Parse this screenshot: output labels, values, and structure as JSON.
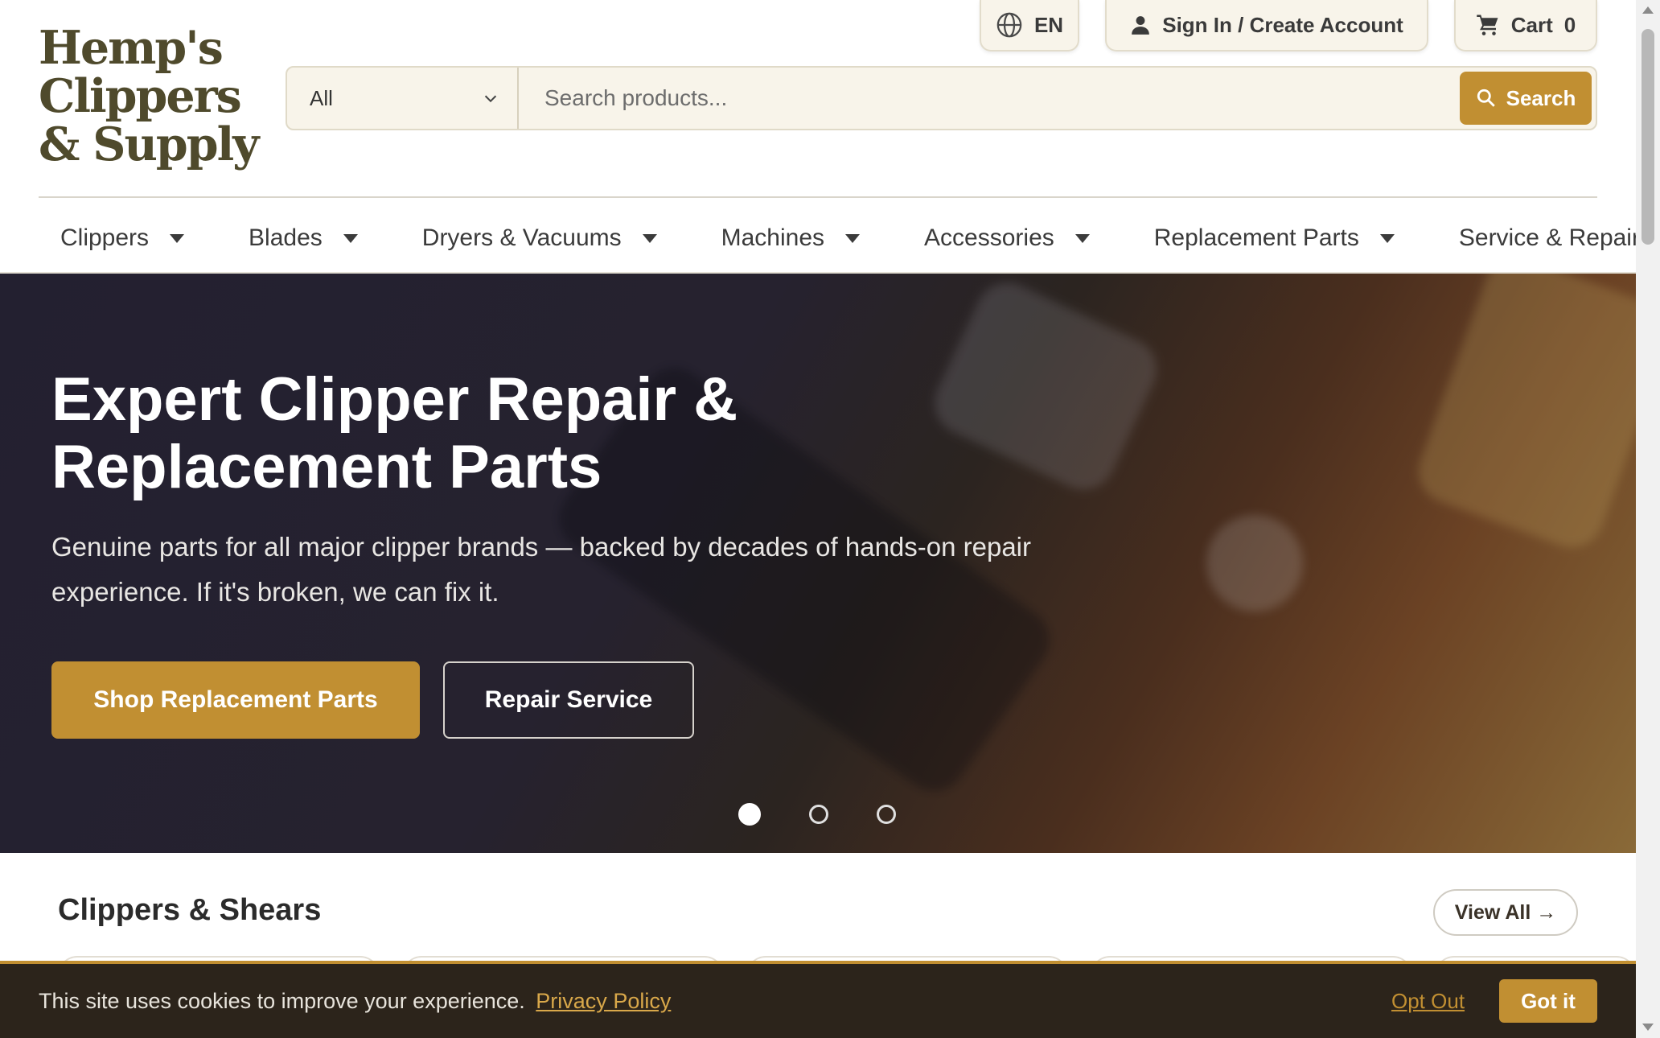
{
  "brand": {
    "logo_lines": [
      "Hemp's",
      "Clippers",
      "& Supply"
    ],
    "accent_color": "#c18f32",
    "logo_color": "#4f4a2c"
  },
  "utility": {
    "language": "EN",
    "account_label": "Sign In / Create Account",
    "cart_label": "Cart",
    "cart_count": "0"
  },
  "search": {
    "category": "All",
    "placeholder": "Search products...",
    "button_label": "Search"
  },
  "nav": {
    "items": [
      {
        "label": "Clippers",
        "has_dropdown": true
      },
      {
        "label": "Blades",
        "has_dropdown": true
      },
      {
        "label": "Dryers & Vacuums",
        "has_dropdown": true
      },
      {
        "label": "Machines",
        "has_dropdown": true
      },
      {
        "label": "Accessories",
        "has_dropdown": true
      },
      {
        "label": "Replacement Parts",
        "has_dropdown": true
      },
      {
        "label": "Service & Repair",
        "has_dropdown": false
      }
    ]
  },
  "hero": {
    "title": "Expert Clipper Repair & Replacement Parts",
    "subtitle": "Genuine parts for all major clipper brands — backed by decades of hands-on repair experience. If it's broken, we can fix it.",
    "primary_cta": "Shop Replacement Parts",
    "secondary_cta": "Repair Service",
    "slide_count": 3,
    "active_slide": 1
  },
  "section": {
    "title": "Clippers & Shears",
    "view_all": "View All →"
  },
  "cookie": {
    "message": "This site uses cookies to improve your experience.",
    "policy_link": "Privacy Policy",
    "opt_out": "Opt Out",
    "accept": "Got it"
  }
}
